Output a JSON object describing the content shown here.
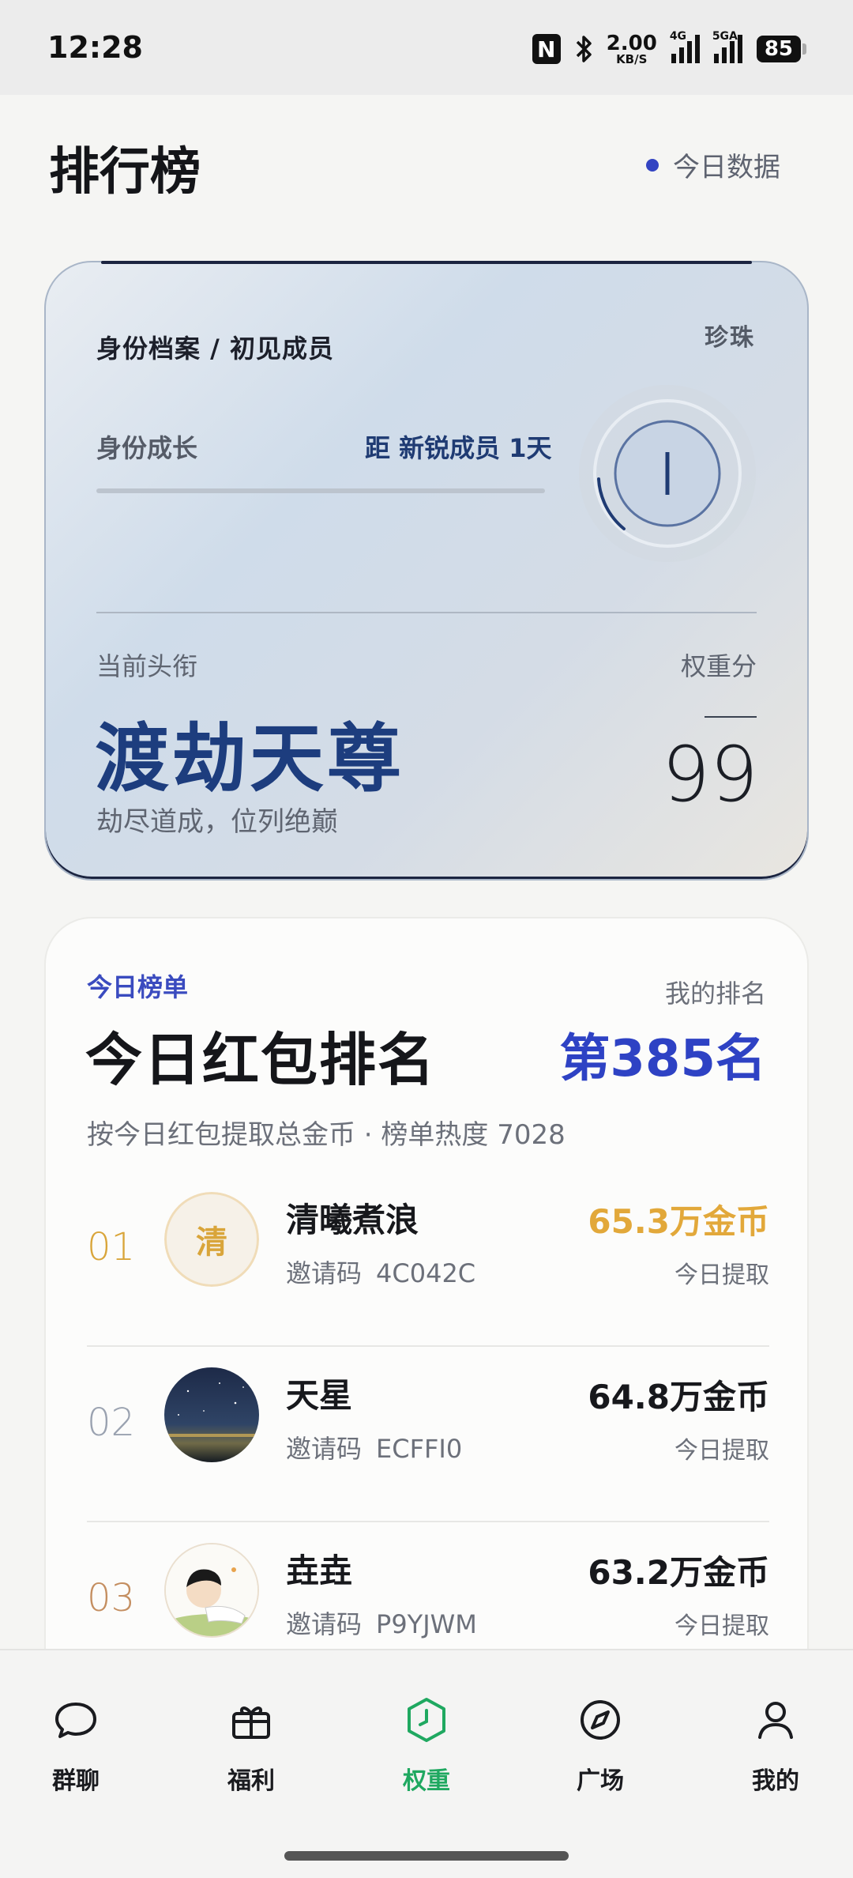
{
  "status_bar": {
    "time": "12:28",
    "nfc": "N",
    "net_speed_value": "2.00",
    "net_speed_unit": "KB/S",
    "signal1_tag": "4G",
    "signal2_tag": "5GA",
    "battery": "85"
  },
  "header": {
    "title": "排行榜",
    "today_link": "今日数据",
    "accent_color": "#3344c2"
  },
  "identity": {
    "breadcrumb": "身份档案 / 初见成员",
    "tier_badge": "珍珠",
    "growth_label": "身份成长",
    "growth_target": "距 新锐成员 1天",
    "growth_progress": 0.0,
    "current_title_label": "当前头衔",
    "current_title": "渡劫天尊",
    "current_title_desc": "劫尽道成，位列绝巅",
    "weight_label": "权重分",
    "weight_score": "99"
  },
  "ranking": {
    "eyebrow": "今日榜单",
    "title": "今日红包排名",
    "my_rank_label": "我的排名",
    "my_rank": "第385名",
    "subtitle": "按今日红包提取总金币 · 榜单热度 7028",
    "invite_label": "邀请码",
    "rows": [
      {
        "rank": "01",
        "avatar_text": "清",
        "name": "清曦煮浪",
        "invite_code": "4C042C",
        "coins": "65.3万金币",
        "today": "今日提取"
      },
      {
        "rank": "02",
        "name": "天星",
        "invite_code": "ECFFI0",
        "coins": "64.8万金币",
        "today": "今日提取"
      },
      {
        "rank": "03",
        "name": "垚垚",
        "invite_code": "P9YJWM",
        "coins": "63.2万金币",
        "today": "今日提取"
      }
    ]
  },
  "bottom_nav": {
    "active_color": "#1fa860",
    "items": [
      {
        "label": "群聊",
        "icon": "chat-bubble-icon"
      },
      {
        "label": "福利",
        "icon": "gift-icon"
      },
      {
        "label": "权重",
        "icon": "hexagon-clock-icon"
      },
      {
        "label": "广场",
        "icon": "compass-icon"
      },
      {
        "label": "我的",
        "icon": "person-icon"
      }
    ]
  }
}
